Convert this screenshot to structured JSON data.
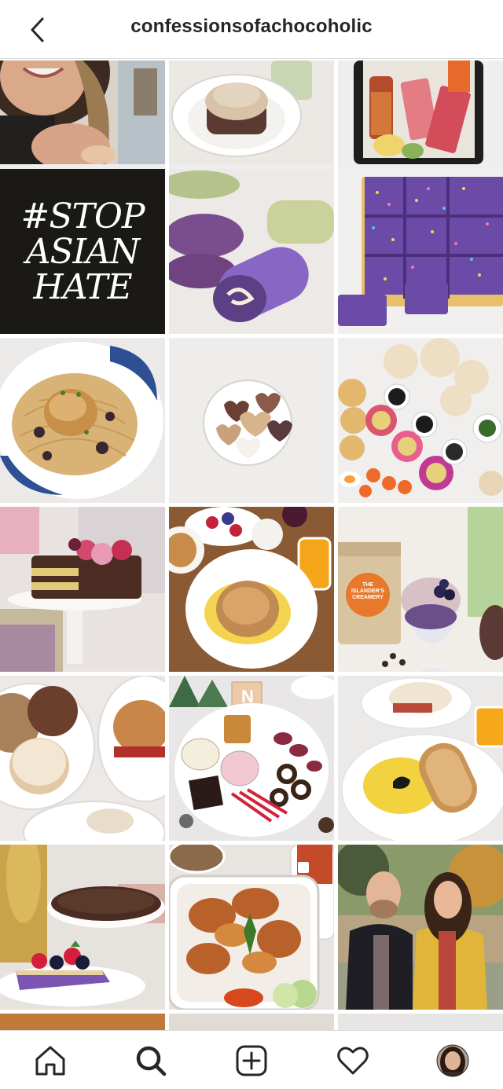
{
  "header": {
    "title": "confessionsofachocoholic",
    "back_icon": "chevron-left-icon"
  },
  "grid": {
    "tiles": [
      {
        "subject": "smiling woman selfie"
      },
      {
        "subject": "cream topped cake on plate"
      },
      {
        "subject": "sashimi bento"
      },
      {
        "subject": "stop asian hate graphic",
        "lines": [
          "#STOP",
          "ASIAN",
          "HATE"
        ]
      },
      {
        "subject": "ube swiss roll"
      },
      {
        "subject": "purple sprinkle bars"
      },
      {
        "subject": "spaghetti with crab cake"
      },
      {
        "subject": "heart chocolates in bowl"
      },
      {
        "subject": "caviar and chips spread"
      },
      {
        "subject": "layer cake with roses"
      },
      {
        "subject": "breakfast biscuit sandwich"
      },
      {
        "subject": "ice cream sundae",
        "label": "THE ISLANDER'S CREAMERY"
      },
      {
        "subject": "donuts and burger"
      },
      {
        "subject": "holiday charcuterie board",
        "label": "N"
      },
      {
        "subject": "scrambled eggs and toast"
      },
      {
        "subject": "ube cake slice with berries"
      },
      {
        "subject": "fried chicken takeout"
      },
      {
        "subject": "couple portrait outdoors"
      }
    ]
  },
  "bottom_nav": {
    "items": [
      "home-icon",
      "search-icon",
      "new-post-icon",
      "activity-heart-icon",
      "profile-avatar"
    ],
    "active": "search-icon"
  },
  "colors": {
    "text": "#262626",
    "border": "#dbdbdb",
    "stop_bg": "#1a1915",
    "ube": "#6b4aa8"
  }
}
